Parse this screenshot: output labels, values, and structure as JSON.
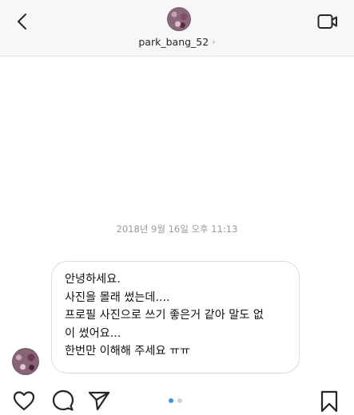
{
  "header": {
    "username": "park_bang_52",
    "chevron": "›",
    "icons": {
      "back": "chevron-left-icon",
      "video": "video-camera-icon"
    }
  },
  "conversation": {
    "timestamp": "2018년 9월 16일 오후 11:13",
    "message_lines": [
      "안녕하세요.",
      "사진을 몰래 썼는데....",
      "프로필 사진으로 쓰기 좋은거 같아 말도 없",
      "이 썼어요...",
      "한번만 이해해 주세요 ㅠㅠ"
    ]
  },
  "footer": {
    "icons": {
      "like": "heart-icon",
      "comment": "comment-icon",
      "share": "paper-plane-icon",
      "save": "bookmark-icon"
    },
    "carousel": {
      "count": 2,
      "active_index": 0
    }
  },
  "colors": {
    "accent": "#3897f0",
    "header_bg": "#f7f7f7",
    "border": "#dcdcdc",
    "muted_text": "#9a9a9a"
  }
}
